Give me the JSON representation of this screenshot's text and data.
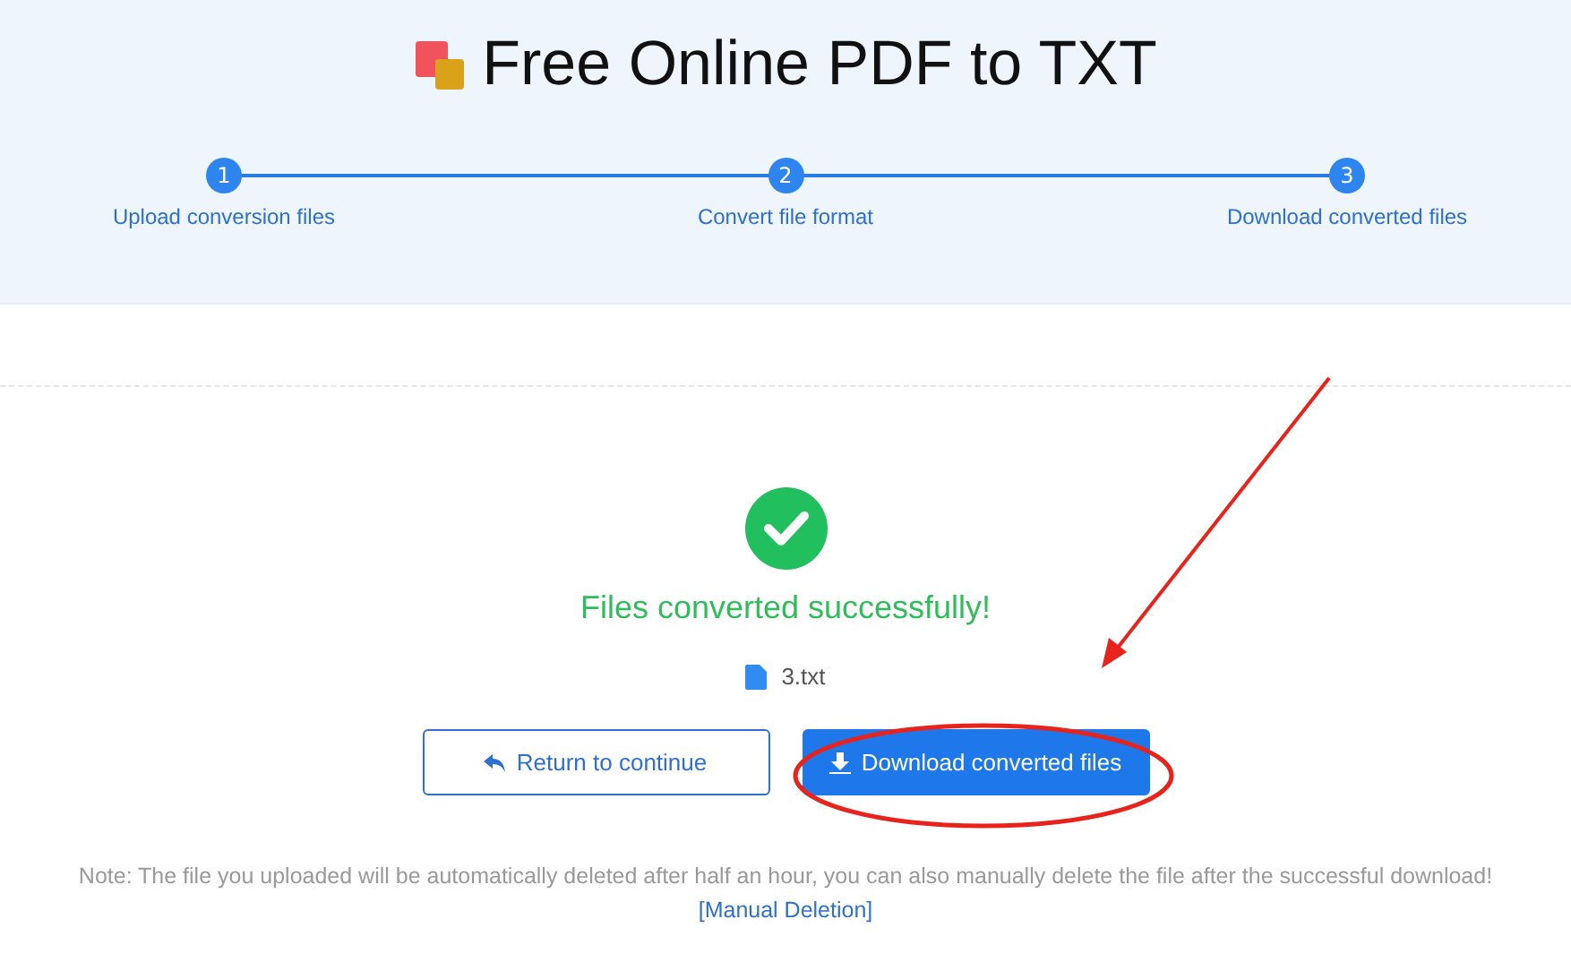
{
  "header": {
    "title": "Free Online PDF to TXT"
  },
  "steps": [
    {
      "number": "1",
      "label": "Upload conversion files"
    },
    {
      "number": "2",
      "label": "Convert file format"
    },
    {
      "number": "3",
      "label": "Download converted files"
    }
  ],
  "result": {
    "message": "Files converted successfully!",
    "file": "3.txt"
  },
  "buttons": [
    {
      "kind": "outline",
      "label": "Return to continue"
    },
    {
      "kind": "primary",
      "label": "Download converted files"
    }
  ],
  "note": {
    "text": "Note: The file you uploaded will be automatically deleted after half an hour, you can also manually delete the file after the successful download!",
    "link": "[Manual Deletion]"
  }
}
